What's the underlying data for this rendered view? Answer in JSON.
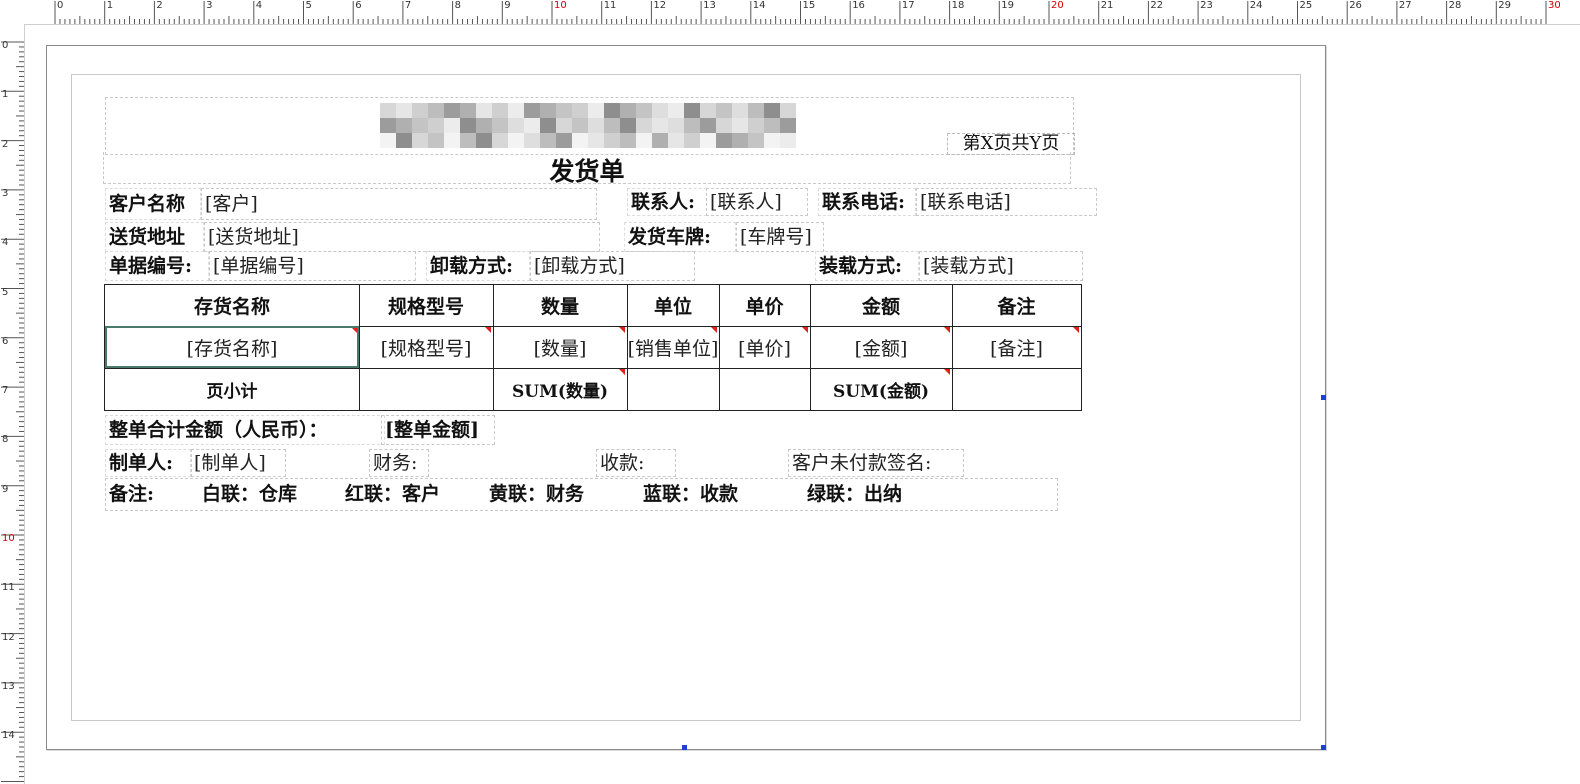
{
  "ruler": {
    "horizontal": [
      "0",
      "1",
      "2",
      "3",
      "4",
      "5",
      "6",
      "7",
      "8",
      "9",
      "10",
      "11",
      "12",
      "13",
      "14",
      "15",
      "16",
      "17",
      "18",
      "19",
      "20",
      "21",
      "22",
      "23",
      "24",
      "25",
      "26",
      "27",
      "28",
      "29",
      "30"
    ],
    "vertical": [
      "0",
      "1",
      "2",
      "3",
      "4",
      "5",
      "6",
      "7",
      "8",
      "9",
      "10",
      "11",
      "12",
      "13",
      "14"
    ],
    "highlight_color": "#d40000"
  },
  "report": {
    "title": "发货单",
    "page_counter": "第X页共Y页",
    "header": {
      "customer_label": "客户名称",
      "customer_value": "[客户]",
      "contact_label": "联系人:",
      "contact_value": "[联系人]",
      "phone_label": "联系电话:",
      "phone_value": "[联系电话]",
      "address_label": "送货地址",
      "address_value": "[送货地址]",
      "plate_label": "发货车牌:",
      "plate_value": "[车牌号]",
      "docno_label": "单据编号:",
      "docno_value": "[单据编号]",
      "unload_label": "卸载方式:",
      "unload_value": "[卸载方式]",
      "load_label": "装载方式:",
      "load_value": "[装载方式]"
    },
    "table": {
      "columns": [
        "存货名称",
        "规格型号",
        "数量",
        "单位",
        "单价",
        "金额",
        "备注"
      ],
      "detail_row": [
        "[存货名称]",
        "[规格型号]",
        "[数量]",
        "[销售单位]",
        "[单价]",
        "[金额]",
        "[备注]"
      ],
      "subtotal_row": [
        "页小计",
        "",
        "SUM(数量)",
        "",
        "",
        "SUM(金额)",
        ""
      ]
    },
    "footer": {
      "total_label": "整单合计金额（人民币）：",
      "total_value": "[整单金额]",
      "maker_label": "制单人:",
      "maker_value": "[制单人]",
      "finance_label": "财务:",
      "cashier_label": "收款:",
      "sign_label": "客户未付款签名:",
      "note_label": "备注:",
      "copies": [
        "白联：仓库",
        "红联：客户",
        "黄联：财务",
        "蓝联：收款",
        "绿联：出纳"
      ]
    }
  },
  "colors": {
    "selection_handle": "#1f3fd9",
    "expression_flag": "#e0201a",
    "dashed_border": "#c9c9c9"
  }
}
